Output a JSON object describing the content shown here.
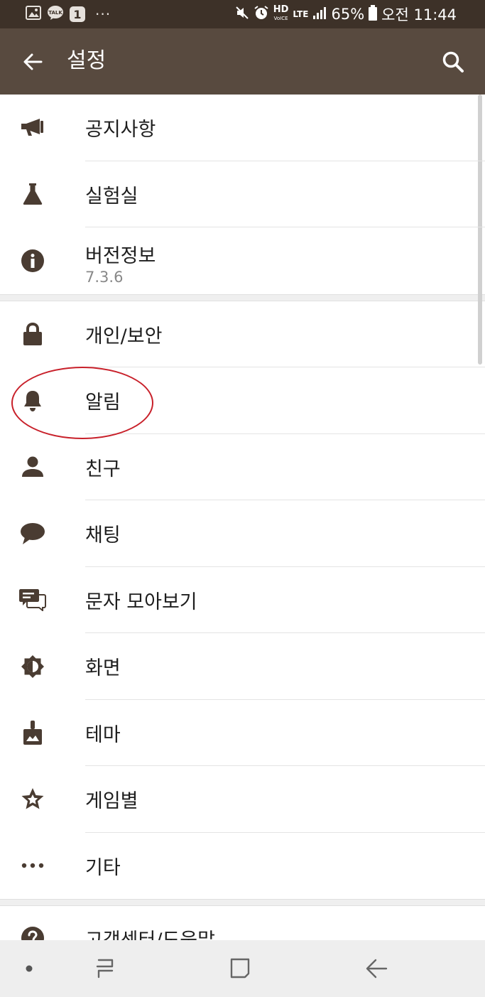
{
  "status_bar": {
    "notification_badge": "1",
    "more_dots": "···",
    "hd_label": "HD",
    "hd_sub": "VoICE",
    "lte_label": "LTE",
    "battery_percent": "65%",
    "time": "오전 11:44",
    "icons": [
      "gallery-icon",
      "kakaotalk-icon",
      "mute-icon",
      "alarm-icon",
      "signal-icon",
      "battery-icon"
    ]
  },
  "app_bar": {
    "title": "설정",
    "background": "#584a3f"
  },
  "section1": [
    {
      "icon": "megaphone-icon",
      "label": "공지사항"
    },
    {
      "icon": "flask-icon",
      "label": "실험실"
    },
    {
      "icon": "info-icon",
      "label": "버전정보",
      "sub": "7.3.6"
    }
  ],
  "section2": [
    {
      "icon": "lock-icon",
      "label": "개인/보안"
    },
    {
      "icon": "bell-icon",
      "label": "알림",
      "highlighted": true
    },
    {
      "icon": "person-icon",
      "label": "친구"
    },
    {
      "icon": "chat-bubble-icon",
      "label": "채팅"
    },
    {
      "icon": "message-icon",
      "label": "문자 모아보기"
    },
    {
      "icon": "brightness-icon",
      "label": "화면"
    },
    {
      "icon": "paint-brush-icon",
      "label": "테마"
    },
    {
      "icon": "star-badge-icon",
      "label": "게임별"
    },
    {
      "icon": "more-icon",
      "label": "기타"
    }
  ],
  "section3": [
    {
      "icon": "help-icon",
      "label": "고객센터/도움말"
    }
  ],
  "colors": {
    "status_bar": "#3d3128",
    "icon": "#4a3c32",
    "highlight": "#c8202a"
  }
}
